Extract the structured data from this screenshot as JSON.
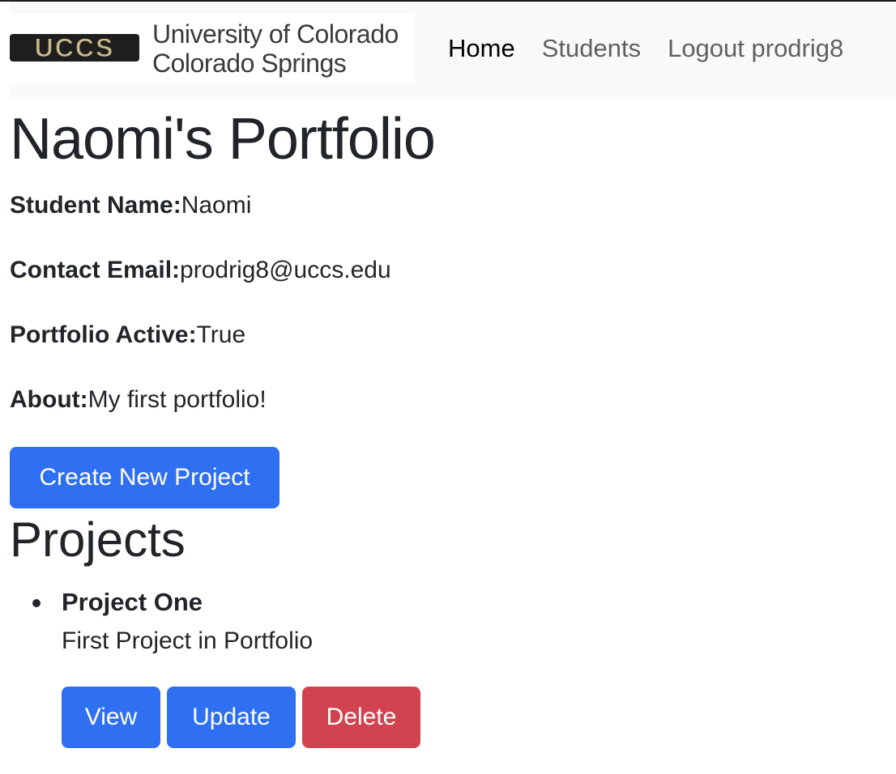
{
  "navbar": {
    "logo_mark_text": "UCCS",
    "logo_line1": "University of Colorado",
    "logo_line2": "Colorado Springs",
    "links": [
      {
        "label": "Home",
        "active": true
      },
      {
        "label": "Students",
        "active": false
      },
      {
        "label": "Logout prodrig8",
        "active": false
      }
    ]
  },
  "page": {
    "title": "Naomi's Portfolio",
    "fields": [
      {
        "label": "Student Name:",
        "value": "Naomi"
      },
      {
        "label": "Contact Email:",
        "value": "prodrig8@uccs.edu"
      },
      {
        "label": "Portfolio Active:",
        "value": "True"
      },
      {
        "label": "About:",
        "value": "My first portfolio!"
      }
    ],
    "create_button": "Create New Project",
    "projects_heading": "Projects",
    "projects": [
      {
        "name": "Project One",
        "description": "First Project in Portfolio",
        "actions": {
          "view": "View",
          "update": "Update",
          "delete": "Delete"
        }
      }
    ]
  },
  "colors": {
    "primary": "#2f6ff2",
    "danger": "#d1444f",
    "navbar_bg": "#f8f9fa",
    "logo_gold": "#c8b88a"
  }
}
